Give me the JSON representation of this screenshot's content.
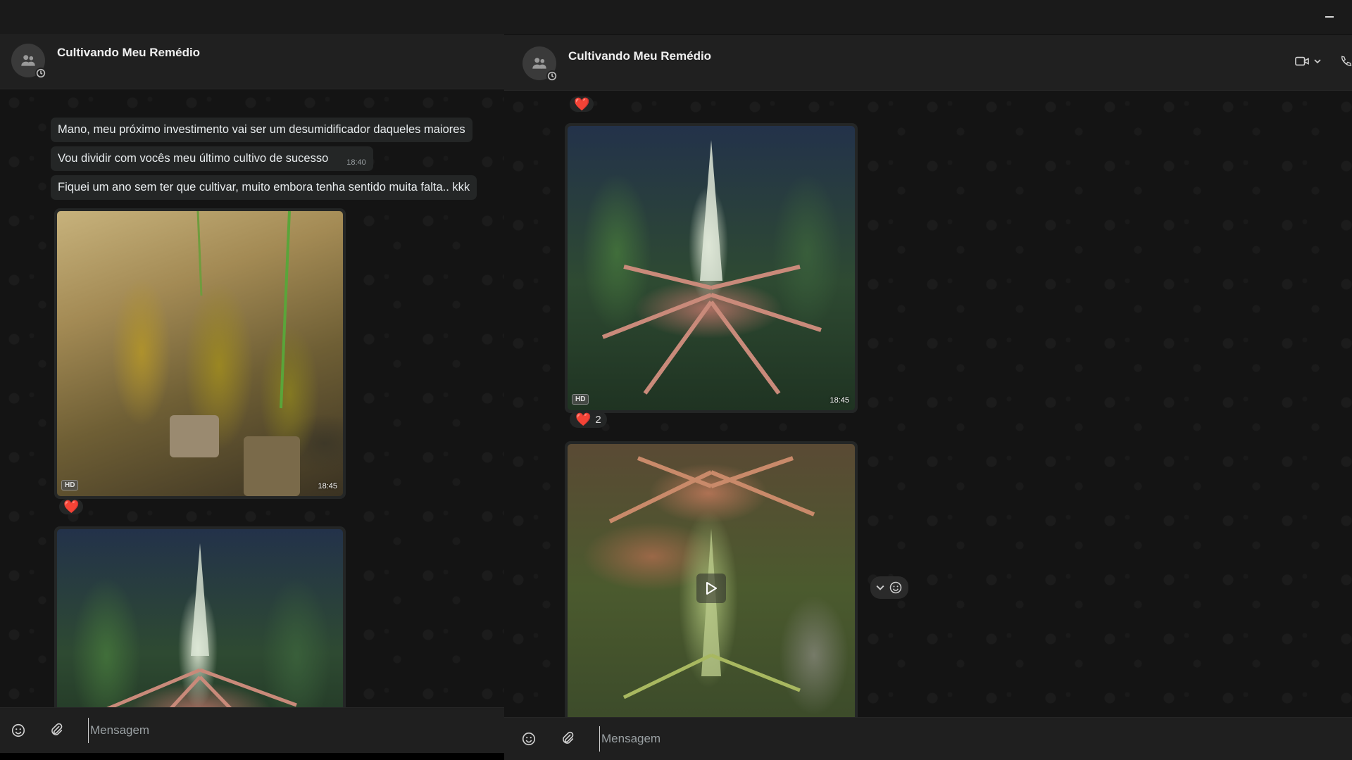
{
  "window": {
    "minimize_label": "—"
  },
  "left_chat": {
    "title": "Cultivando Meu Remédio",
    "messages": [
      {
        "text": "Mano, meu próximo investimento vai ser um desumidificador daqueles maiores"
      },
      {
        "text": "Vou dividir com vocês meu último cultivo de sucesso",
        "time": "18:40"
      },
      {
        "text": "Fiquei um ano sem ter que cultivar, muito embora tenha sentido muita falta.. kkk"
      }
    ],
    "photo1": {
      "badge": "HD",
      "time": "18:45",
      "reaction": "❤️"
    },
    "composer": {
      "placeholder": "Mensagem"
    }
  },
  "right_chat": {
    "title": "Cultivando Meu Remédio",
    "top_reaction": "❤️",
    "photo1": {
      "badge": "HD",
      "time": "18:45",
      "reaction": "❤️",
      "reaction_count": "2"
    },
    "composer": {
      "placeholder": "Mensagem"
    }
  }
}
